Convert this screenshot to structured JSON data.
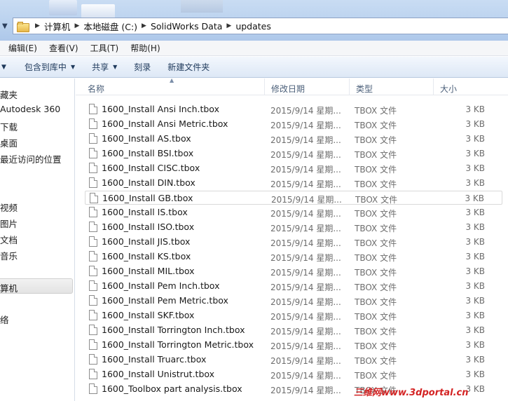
{
  "address": {
    "crumbs": [
      "计算机",
      "本地磁盘 (C:)",
      "SolidWorks Data",
      "updates"
    ]
  },
  "menu": [
    "编辑(E)",
    "查看(V)",
    "工具(T)",
    "帮助(H)"
  ],
  "commands": [
    {
      "label": "包含到库中",
      "dropdown": true
    },
    {
      "label": "共享",
      "dropdown": true
    },
    {
      "label": "刻录",
      "dropdown": false
    },
    {
      "label": "新建文件夹",
      "dropdown": false
    }
  ],
  "sidebar": [
    "藏夹",
    "Autodesk 360",
    "下载",
    "桌面",
    "最近访问的位置",
    "",
    "视频",
    "图片",
    "文档",
    "音乐",
    "算机",
    "络"
  ],
  "columns": {
    "name": "名称",
    "date": "修改日期",
    "type": "类型",
    "size": "大小"
  },
  "files": [
    {
      "name": "1600_Install Ansi Inch.tbox",
      "date": "2015/9/14 星期...",
      "type": "TBOX 文件",
      "size": "3 KB"
    },
    {
      "name": "1600_Install Ansi Metric.tbox",
      "date": "2015/9/14 星期...",
      "type": "TBOX 文件",
      "size": "3 KB"
    },
    {
      "name": "1600_Install AS.tbox",
      "date": "2015/9/14 星期...",
      "type": "TBOX 文件",
      "size": "3 KB"
    },
    {
      "name": "1600_Install BSI.tbox",
      "date": "2015/9/14 星期...",
      "type": "TBOX 文件",
      "size": "3 KB"
    },
    {
      "name": "1600_Install CISC.tbox",
      "date": "2015/9/14 星期...",
      "type": "TBOX 文件",
      "size": "3 KB"
    },
    {
      "name": "1600_Install DIN.tbox",
      "date": "2015/9/14 星期...",
      "type": "TBOX 文件",
      "size": "3 KB"
    },
    {
      "name": "1600_Install GB.tbox",
      "date": "2015/9/14 星期...",
      "type": "TBOX 文件",
      "size": "3 KB",
      "selected": true
    },
    {
      "name": "1600_Install IS.tbox",
      "date": "2015/9/14 星期...",
      "type": "TBOX 文件",
      "size": "3 KB"
    },
    {
      "name": "1600_Install ISO.tbox",
      "date": "2015/9/14 星期...",
      "type": "TBOX 文件",
      "size": "3 KB"
    },
    {
      "name": "1600_Install JIS.tbox",
      "date": "2015/9/14 星期...",
      "type": "TBOX 文件",
      "size": "3 KB"
    },
    {
      "name": "1600_Install KS.tbox",
      "date": "2015/9/14 星期...",
      "type": "TBOX 文件",
      "size": "3 KB"
    },
    {
      "name": "1600_Install MIL.tbox",
      "date": "2015/9/14 星期...",
      "type": "TBOX 文件",
      "size": "3 KB"
    },
    {
      "name": "1600_Install Pem Inch.tbox",
      "date": "2015/9/14 星期...",
      "type": "TBOX 文件",
      "size": "3 KB"
    },
    {
      "name": "1600_Install Pem Metric.tbox",
      "date": "2015/9/14 星期...",
      "type": "TBOX 文件",
      "size": "3 KB"
    },
    {
      "name": "1600_Install SKF.tbox",
      "date": "2015/9/14 星期...",
      "type": "TBOX 文件",
      "size": "3 KB"
    },
    {
      "name": "1600_Install Torrington Inch.tbox",
      "date": "2015/9/14 星期...",
      "type": "TBOX 文件",
      "size": "3 KB"
    },
    {
      "name": "1600_Install Torrington Metric.tbox",
      "date": "2015/9/14 星期...",
      "type": "TBOX 文件",
      "size": "3 KB"
    },
    {
      "name": "1600_Install Truarc.tbox",
      "date": "2015/9/14 星期...",
      "type": "TBOX 文件",
      "size": "3 KB"
    },
    {
      "name": "1600_Install Unistrut.tbox",
      "date": "2015/9/14 星期...",
      "type": "TBOX 文件",
      "size": "3 KB"
    },
    {
      "name": "1600_Toolbox part analysis.tbox",
      "date": "2015/9/14 星期...",
      "type": "TBOX 文件",
      "size": "3 KB"
    }
  ],
  "watermark": "三维网www.3dportal.cn",
  "colors": {
    "accent": "#1e395b",
    "selection": "#d9d9d9",
    "watermark": "#d42424"
  }
}
